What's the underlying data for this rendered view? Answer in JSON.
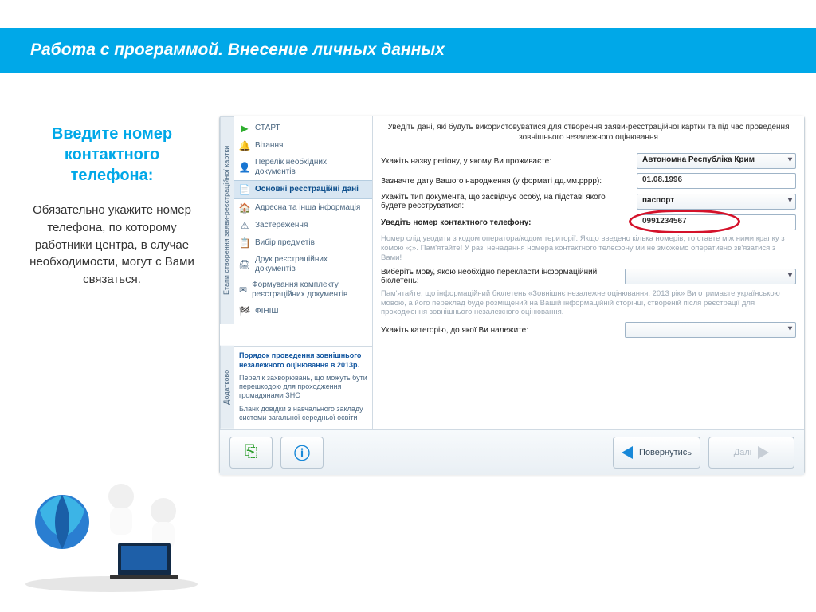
{
  "banner": {
    "title": "Работа с программой. Внесение личных данных"
  },
  "instruction": {
    "title": "Введите номер контактного телефона:",
    "body": "Обязательно укажите номер телефона, по которому работники центра, в случае необходимости, могут с Вами связаться."
  },
  "sidebar": {
    "vtab_top": "Етапи створення заяви-реєстраційної картки",
    "vtab_bottom": "Додатково",
    "items": [
      {
        "label": "СТАРТ",
        "icon": "▶",
        "color": "#2fae2f"
      },
      {
        "label": "Вітання",
        "icon": "🔔",
        "color": "#e0a030"
      },
      {
        "label": "Перелік необхідних документів",
        "icon": "👤",
        "color": "#7a8aa0"
      },
      {
        "label": "Основні реєстраційні дані",
        "icon": "📄",
        "color": "#1256a0"
      },
      {
        "label": "Адресна та інша інформація",
        "icon": "🏠",
        "color": "#7a8aa0"
      },
      {
        "label": "Застереження",
        "icon": "⚠",
        "color": "#7a8aa0"
      },
      {
        "label": "Вибір предметів",
        "icon": "📋",
        "color": "#7a8aa0"
      },
      {
        "label": "Друк реєстраційних документів",
        "icon": "🖨",
        "color": "#7a8aa0"
      },
      {
        "label": "Формування комплекту реєстраційних документів",
        "icon": "✉",
        "color": "#7a8aa0"
      },
      {
        "label": "ФІНІШ",
        "icon": "🏁",
        "color": "#555"
      }
    ],
    "extra": {
      "title": "Порядок проведення зовнішнього незалежного оцінювання  в 2013р.",
      "link1": "Перелік захворювань, що можуть бути перешкодою для проходження громадянами ЗНО",
      "link2": "Бланк довідки з навчального закладу системи загальної середньої освіти"
    }
  },
  "form": {
    "header": "Уведіть дані, які будуть використовуватися для створення заяви-реєстраційної картки та під час проведення зовнішнього незалежного оцінювання",
    "region_label": "Укажіть назву регіону, у якому Ви проживаєте:",
    "region_value": "Автономна Республіка Крим",
    "dob_label": "Зазначте дату Вашого народження (у форматі дд.мм.рррр):",
    "dob_value": "01.08.1996",
    "doc_label": "Укажіть тип документа, що засвідчує особу, на підставі якого будете реєструватися:",
    "doc_value": "паспорт",
    "phone_label": "Уведіть номер контактного телефону:",
    "phone_value": "0991234567",
    "phone_hint": "Номер слід уводити з кодом оператора/кодом території. Якщо введено кілька номерів, то ставте між ними крапку з комою «;». Пам'ятайте! У разі ненадання номера контактного телефону ми не зможемо оперативно зв'язатися з Вами!",
    "lang_label": "Виберіть мову, якою необхідно перекласти інформаційний бюлетень:",
    "lang_hint": "Пам'ятайте, що інформаційний бюлетень «Зовнішнє незалежне оцінювання. 2013 рік» Ви отримаєте українською мовою, а його переклад буде розміщений на Вашій інформаційній сторінці, створеній після реєстрації для проходження зовнішнього незалежного оцінювання.",
    "cat_label": "Укажіть категорію, до якої Ви належите:"
  },
  "footer": {
    "back": "Повернутись",
    "next": "Далі"
  }
}
